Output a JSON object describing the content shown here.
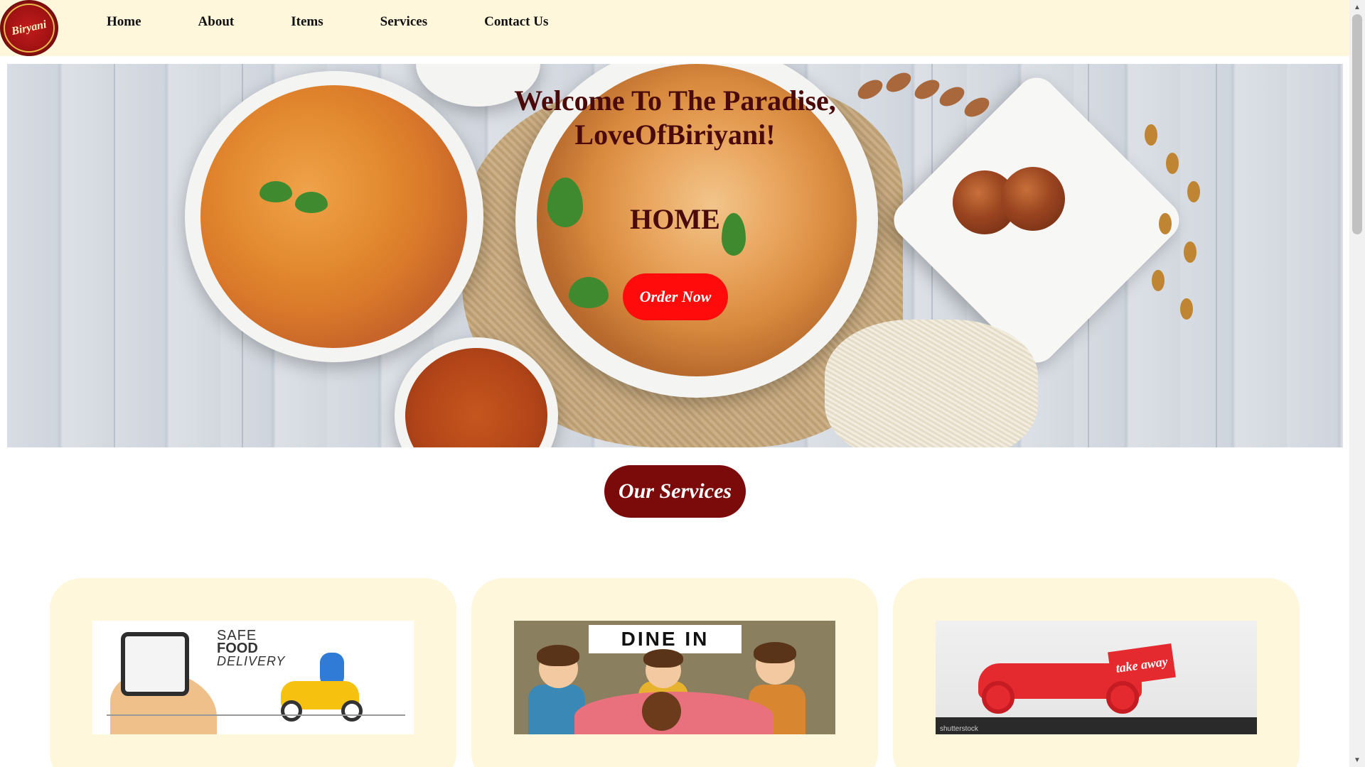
{
  "logo": {
    "text": "Biryani"
  },
  "nav": {
    "items": [
      {
        "label": "Home"
      },
      {
        "label": "About"
      },
      {
        "label": "Items"
      },
      {
        "label": "Services"
      },
      {
        "label": "Contact Us"
      }
    ]
  },
  "hero": {
    "title_line1": "Welcome To The Paradise,",
    "title_line2": "LoveOfBiriyani!",
    "subtitle": "HOME",
    "cta_label": "Order Now"
  },
  "services": {
    "heading": "Our Services",
    "cards": [
      {
        "image_text": {
          "line1": "SAFE",
          "line2": "FOOD",
          "line3": "DELIVERY"
        }
      },
      {
        "image_text": {
          "banner": "DINE IN"
        }
      },
      {
        "image_text": {
          "box": "take away",
          "watermark": "shutterstock"
        }
      }
    ]
  },
  "colors": {
    "nav_bg": "#fff7dc",
    "hero_text": "#4a0a0a",
    "cta_bg": "#ff0b0b",
    "services_pill_bg": "#7b0a0a",
    "card_bg": "#fff7dc"
  }
}
